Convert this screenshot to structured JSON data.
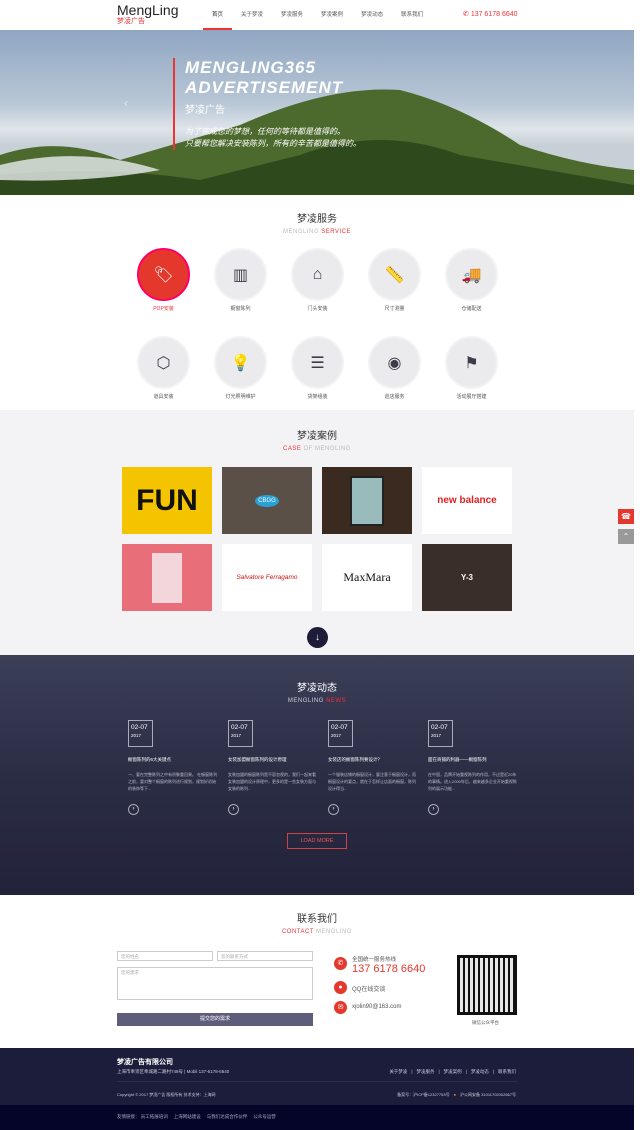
{
  "header": {
    "logo_en": "MengLing",
    "logo_cn": "梦凌广告",
    "nav": [
      "首页",
      "关于梦凌",
      "梦凌服务",
      "梦凌案例",
      "梦凌动态",
      "联系我们"
    ],
    "phone": "137 6178 6640"
  },
  "hero": {
    "title1": "MENGLING365",
    "title2": "ADVERTISEMENT",
    "subtitle": "梦凌广告",
    "slogan1": "为了完成您的梦想，任何的等待都是值得的。",
    "slogan2": "只要帮您解决安装陈列，所有的辛苦都是值得的。"
  },
  "services": {
    "title": "梦凌服务",
    "sub_a": "MENGLING ",
    "sub_b": "SERVICE",
    "items": [
      {
        "label": "POP安装",
        "icon": "tag-icon"
      },
      {
        "label": "橱窗陈列",
        "icon": "window-icon"
      },
      {
        "label": "门头安装",
        "icon": "storefront-icon"
      },
      {
        "label": "尺寸测量",
        "icon": "ruler-icon"
      },
      {
        "label": "仓储配送",
        "icon": "truck-icon"
      },
      {
        "label": "道具安装",
        "icon": "tools-icon"
      },
      {
        "label": "灯光照明维护",
        "icon": "bulb-icon"
      },
      {
        "label": "货架组装",
        "icon": "shelf-icon"
      },
      {
        "label": "巡店服务",
        "icon": "eye-icon"
      },
      {
        "label": "活动展厅搭建",
        "icon": "flag-icon"
      }
    ]
  },
  "cases": {
    "title": "梦凌案例",
    "sub_a": "CASE",
    "sub_b": " OF MENGLING",
    "items": [
      "FUN",
      "CBGG",
      "",
      "new balance",
      "",
      "Salvatore Ferragamo",
      "MaxMara",
      "Y-3"
    ]
  },
  "news": {
    "title": "梦凌动态",
    "sub_a": "MENGLING ",
    "sub_b": "NEWS",
    "load_more": "LOAD MORE",
    "items": [
      {
        "date": "02-07",
        "year": "2017",
        "title": "橱窗陈列的6大关键点",
        "desc": "一、要在完整陈列之中有积聚重回果。 在橱窗陈列之前，要对整个橱窗的陈列进行规划，规划好初始的装饰等下..."
      },
      {
        "date": "02-07",
        "year": "2017",
        "title": "女装加盟橱窗陈列的设计原理",
        "desc": "女装加盟的橱窗陈列是不容忽视的，我们一起来看女装加盟的设计原理中，更多的是一些女装方面与女装的陈列..."
      },
      {
        "date": "02-07",
        "year": "2017",
        "title": "女装店的橱窗陈列要设计？",
        "desc": "一个服装店铺的橱窗设计，要注意于橱窗设计，而橱窗设计的要点，就在于怎样让店面的橱窗，陈列设计得当..."
      },
      {
        "date": "02-07",
        "year": "2017",
        "title": "面在商铺的利器——橱窗陈列",
        "desc": "在中国，品牌开始重视陈列的作用，不过是近20年的事情。进入2000年后，越来越多企业开始重视陈列的展示功能..."
      }
    ]
  },
  "contact": {
    "title": "联系我们",
    "sub_a": "CONTACT",
    "sub_b": " MENGLING",
    "name_ph": "您的姓名",
    "phone_ph": "您的联系方式",
    "need_ph": "您的需求",
    "submit": "提交您的需求",
    "hotline_label": "全国统一服务热线",
    "hotline": "137 6178 6640",
    "qq": "QQ在线交谈",
    "email": "xjolin90@163.com",
    "qr_label": "微信公众平台"
  },
  "footer": {
    "company": "梦凌广告有限公司",
    "address": "上海市奉贤区奉城路二路村748号 | Mobil 137-6178-6640",
    "links": [
      "关于梦凌",
      "梦凌服务",
      "梦凌案例",
      "梦凌动态",
      "联系我们"
    ],
    "copyright": "Copyright © 2017 梦凌广告 版权所有 技术支持：上海网",
    "icp": "备案号：沪ICP备12327753号",
    "police": "沪公网安备 31011702002667号",
    "friend_label": "友情链接：",
    "friends": [
      "员工拓展培训",
      "上海网站建设",
      "与我们达成合作伙伴",
      "公众号运营"
    ]
  },
  "colors": {
    "accent": "#e3382b",
    "navy": "#1c1c3b"
  }
}
